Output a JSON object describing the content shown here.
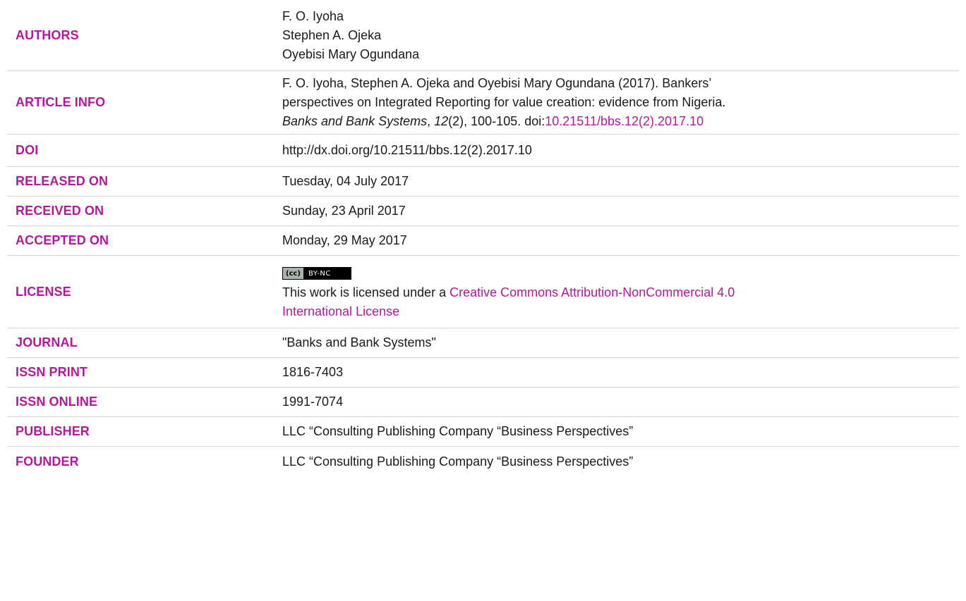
{
  "rows": {
    "authors": {
      "label": "AUTHORS",
      "names": [
        "F. O. Iyoha",
        "Stephen A. Ojeka",
        "Oyebisi Mary Ogundana"
      ]
    },
    "article_info": {
      "label": "ARTICLE INFO",
      "line1": "F. O. Iyoha, Stephen A. Ojeka and Oyebisi Mary Ogundana (2017). Bankers’",
      "line2": "perspectives on Integrated Reporting for value creation: evidence from Nigeria.",
      "journal_italic": "Banks and Bank Systems",
      "sep": ", ",
      "volume_italic": "12",
      "rest": "(2), 100-105. doi:",
      "doi_link": "10.21511/bbs.12(2).2017.10"
    },
    "doi": {
      "label": "DOI",
      "value": "http://dx.doi.org/10.21511/bbs.12(2).2017.10"
    },
    "released": {
      "label": "RELEASED ON",
      "value": "Tuesday, 04 July 2017"
    },
    "received": {
      "label": "RECEIVED ON",
      "value": "Sunday, 23 April 2017"
    },
    "accepted": {
      "label": "ACCEPTED ON",
      "value": "Monday, 29 May 2017"
    },
    "license": {
      "label": "LICENSE",
      "badge_cc": "(cc)",
      "badge_text": "BY-NC",
      "text_prefix": "This work is licensed under a ",
      "link_line1": "Creative Commons Attribution-NonCommercial 4.0",
      "link_line2": "International License"
    },
    "journal": {
      "label": "JOURNAL",
      "value": "\"Banks and Bank Systems\""
    },
    "issn_print": {
      "label": "ISSN PRINT",
      "value": "1816-7403"
    },
    "issn_online": {
      "label": "ISSN ONLINE",
      "value": "1991-7074"
    },
    "publisher": {
      "label": "PUBLISHER",
      "value": "LLC “Consulting Publishing Company “Business Perspectives”"
    },
    "founder": {
      "label": "FOUNDER",
      "value": "LLC “Consulting Publishing Company “Business Perspectives”"
    }
  },
  "colors": {
    "label_accent": "#b3199c",
    "text": "#1a1a1a",
    "divider": "#d6d6d6"
  }
}
